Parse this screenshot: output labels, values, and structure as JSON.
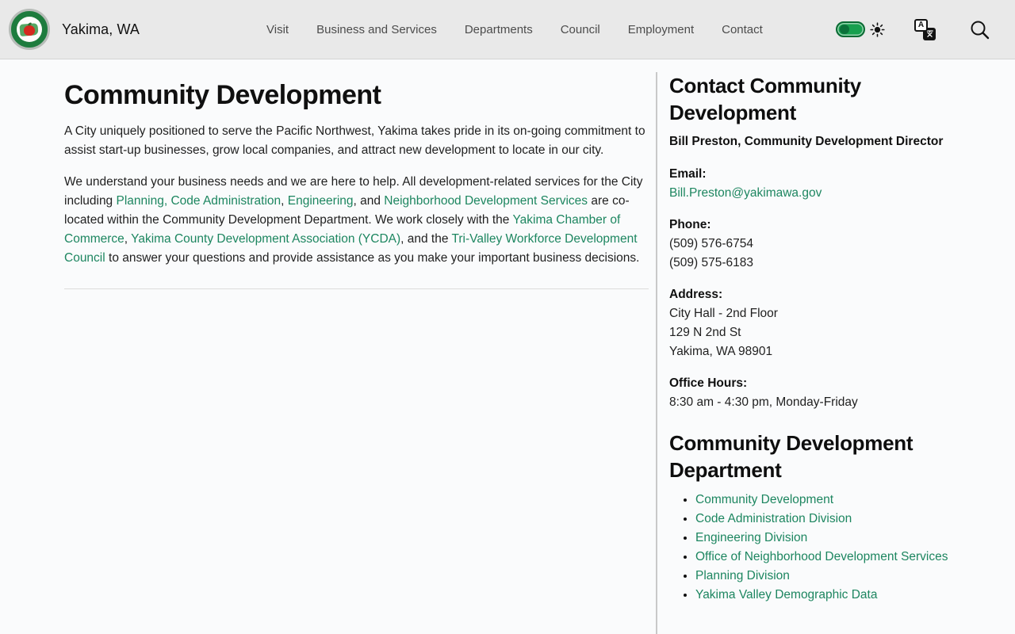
{
  "colors": {
    "link_green": "#1d8660",
    "toggle_green": "#18a04f",
    "header_bg": "#e9e9e9"
  },
  "header": {
    "site_title": "Yakima, WA",
    "logo_alt": "City of Yakima seal",
    "nav_items": [
      {
        "label": "Visit"
      },
      {
        "label": "Business and Services"
      },
      {
        "label": "Departments"
      },
      {
        "label": "Council"
      },
      {
        "label": "Employment"
      },
      {
        "label": "Contact"
      }
    ],
    "icons": {
      "theme_toggle": "toggle-switch (on, green)",
      "sun": "☀",
      "translate": "A/文 translate glyph",
      "search": "magnifier",
      "translate_letter": "A"
    }
  },
  "main": {
    "title": "Community Development",
    "intro": "A City uniquely positioned to serve the Pacific Northwest, Yakima takes pride in its on-going commitment to assist start-up businesses, grow local companies, and attract new development to locate in our city.",
    "body_segments": [
      {
        "text": "We understand your business needs and we are here to help. All development-related services for the City including ",
        "link": false
      },
      {
        "text": "Planning, Code Administration",
        "link": true
      },
      {
        "text": ", ",
        "link": false
      },
      {
        "text": "Engineering",
        "link": true
      },
      {
        "text": ", and ",
        "link": false
      },
      {
        "text": "Neighborhood Development Services",
        "link": true
      },
      {
        "text": " are co-located within the Community Development Department. We work closely with the ",
        "link": false
      },
      {
        "text": "Yakima Chamber of Commerce",
        "link": true
      },
      {
        "text": ", ",
        "link": false
      },
      {
        "text": "Yakima County Development Association (YCDA)",
        "link": true
      },
      {
        "text": ", and the ",
        "link": false
      },
      {
        "text": "Tri-Valley Workforce Development Council",
        "link": true
      },
      {
        "text": " to answer your questions and provide assistance as you make your important business decisions.",
        "link": false
      }
    ]
  },
  "sidebar": {
    "contact_heading": "Contact Community Development",
    "director": "Bill Preston, Community Development Director",
    "email_label": "Email:",
    "email": "Bill.Preston@yakimawa.gov",
    "phone_label": "Phone:",
    "phones": [
      "(509) 576-6754",
      "(509) 575-6183"
    ],
    "address_label": "Address:",
    "address_lines": [
      "City Hall - 2nd Floor",
      "129 N 2nd St",
      "Yakima, WA 98901"
    ],
    "office_hours_label": "Office Hours:",
    "office_hours": "8:30 am - 4:30 pm, Monday-Friday",
    "department_heading": "Community Development Department",
    "department_links": [
      "Community Development",
      "Code Administration Division",
      "Engineering Division",
      "Office of Neighborhood Development Services",
      "Planning Division",
      "Yakima Valley Demographic Data"
    ]
  }
}
